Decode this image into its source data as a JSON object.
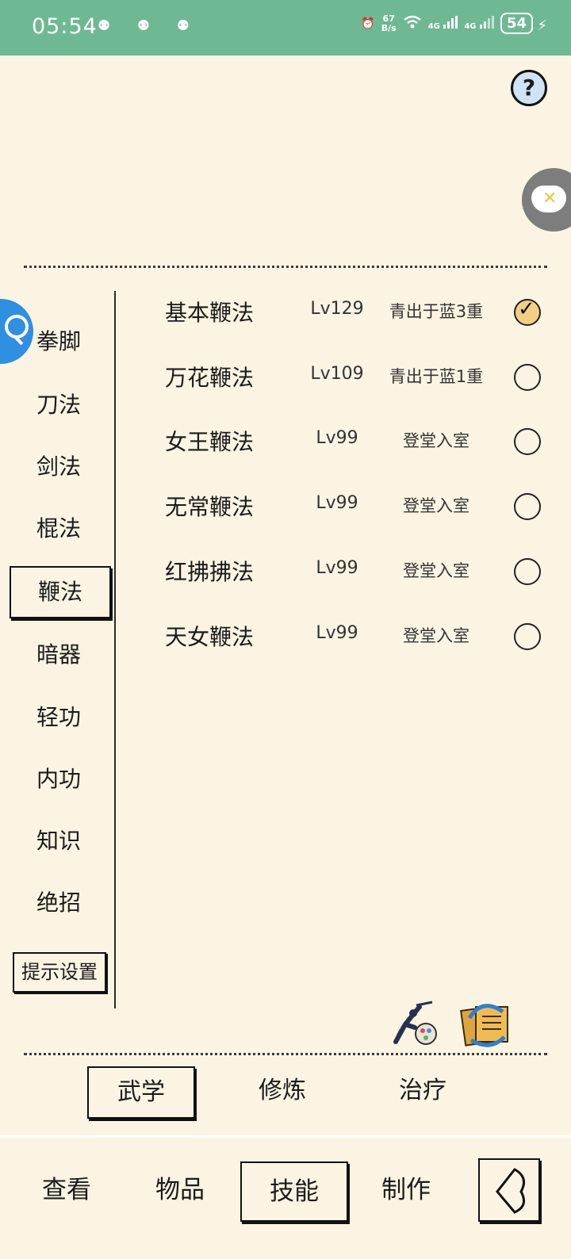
{
  "status_bar": {
    "time": "05:54",
    "notification_dots": "⚉ ⚉ ⚉",
    "net_speed_value": "67",
    "net_speed_unit": "B/s",
    "signal_1": "4G",
    "signal_2": "4G",
    "battery": "54"
  },
  "help": {
    "label": "?"
  },
  "categories": [
    {
      "label": "拳脚"
    },
    {
      "label": "刀法"
    },
    {
      "label": "剑法"
    },
    {
      "label": "棍法"
    },
    {
      "label": "鞭法",
      "active": true
    },
    {
      "label": "暗器"
    },
    {
      "label": "轻功"
    },
    {
      "label": "内功"
    },
    {
      "label": "知识"
    },
    {
      "label": "绝招"
    }
  ],
  "hint_settings_label": "提示设置",
  "skills": [
    {
      "name": "基本鞭法",
      "level": "Lv129",
      "rank": "青出于蓝3重",
      "selected": true
    },
    {
      "name": "万花鞭法",
      "level": "Lv109",
      "rank": "青出于蓝1重",
      "selected": false
    },
    {
      "name": "女王鞭法",
      "level": "Lv99",
      "rank": "登堂入室",
      "selected": false
    },
    {
      "name": "无常鞭法",
      "level": "Lv99",
      "rank": "登堂入室",
      "selected": false
    },
    {
      "name": "红拂拂法",
      "level": "Lv99",
      "rank": "登堂入室",
      "selected": false
    },
    {
      "name": "天女鞭法",
      "level": "Lv99",
      "rank": "登堂入室",
      "selected": false
    }
  ],
  "sub_tabs": [
    {
      "label": "武学",
      "active": true
    },
    {
      "label": "修炼"
    },
    {
      "label": "治疗"
    }
  ],
  "bottom_nav": [
    {
      "label": "查看"
    },
    {
      "label": "物品"
    },
    {
      "label": "技能",
      "active": true
    },
    {
      "label": "制作"
    }
  ],
  "check_mark": "✓"
}
